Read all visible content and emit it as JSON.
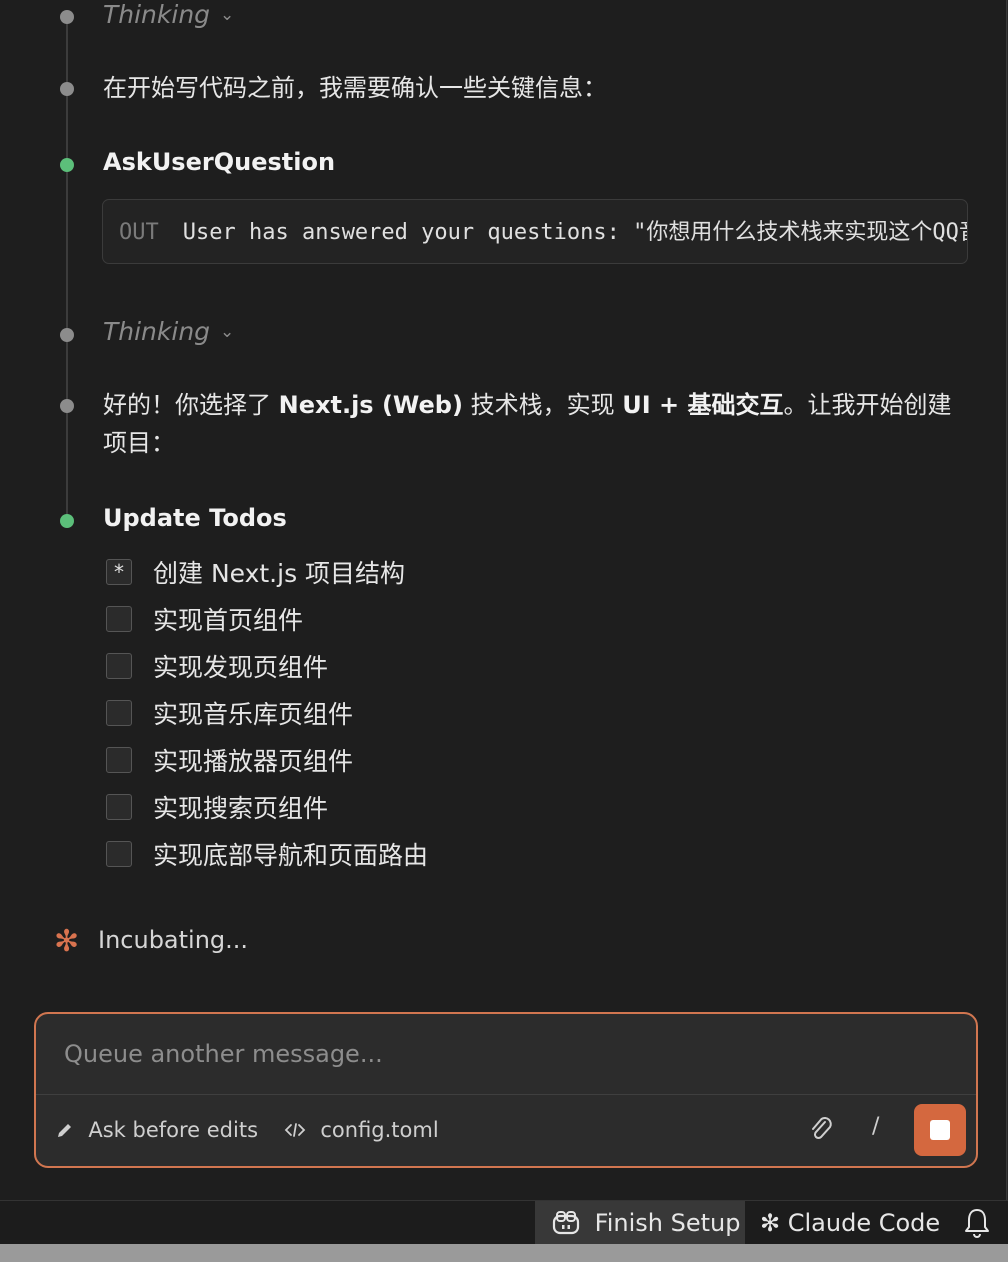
{
  "timeline": {
    "thinking_1": {
      "label": "Thinking",
      "chevron": "⌄"
    },
    "message_1": "在开始写代码之前，我需要确认一些关键信息：",
    "tool_ask": {
      "title": "AskUserQuestion",
      "out_tag": "OUT",
      "out_text": "User has answered your questions: \"你想用什么技术栈来实现这个QQ音乐"
    },
    "thinking_2": {
      "label": "Thinking",
      "chevron": "⌄"
    },
    "message_2": {
      "p1": "好的！你选择了 ",
      "b1": "Next.js (Web)",
      "p2": " 技术栈，实现 ",
      "b2": "UI + 基础交互",
      "p3": "。让我开始创建项目："
    },
    "tool_todos": {
      "title": "Update Todos",
      "items": [
        {
          "label": "创建 Next.js 项目结构",
          "state": "in_progress",
          "mark": "*"
        },
        {
          "label": "实现首页组件",
          "state": "pending",
          "mark": ""
        },
        {
          "label": "实现发现页组件",
          "state": "pending",
          "mark": ""
        },
        {
          "label": "实现音乐库页组件",
          "state": "pending",
          "mark": ""
        },
        {
          "label": "实现播放器页组件",
          "state": "pending",
          "mark": ""
        },
        {
          "label": "实现搜索页组件",
          "state": "pending",
          "mark": ""
        },
        {
          "label": "实现底部导航和页面路由",
          "state": "pending",
          "mark": ""
        }
      ]
    }
  },
  "status": {
    "icon": "✻",
    "label": "Incubating..."
  },
  "composer": {
    "placeholder": "Queue another message...",
    "mode_icon": "pencil-icon",
    "mode_label": "Ask before edits",
    "file_icon": "code-icon",
    "file_label": "config.toml",
    "attach_icon": "paperclip-icon",
    "slash_label": "/",
    "stop_icon": "stop-icon"
  },
  "statusbar": {
    "finish_icon": "copilot-icon",
    "finish_label": "Finish Setup",
    "claude_icon": "✻",
    "claude_label": "Claude Code",
    "bell_icon": "bell-icon"
  },
  "colors": {
    "accent": "#d4683f",
    "green_dot": "#5cbf7a",
    "gray_dot": "#8c8c8c",
    "background": "#1e1e1e"
  }
}
